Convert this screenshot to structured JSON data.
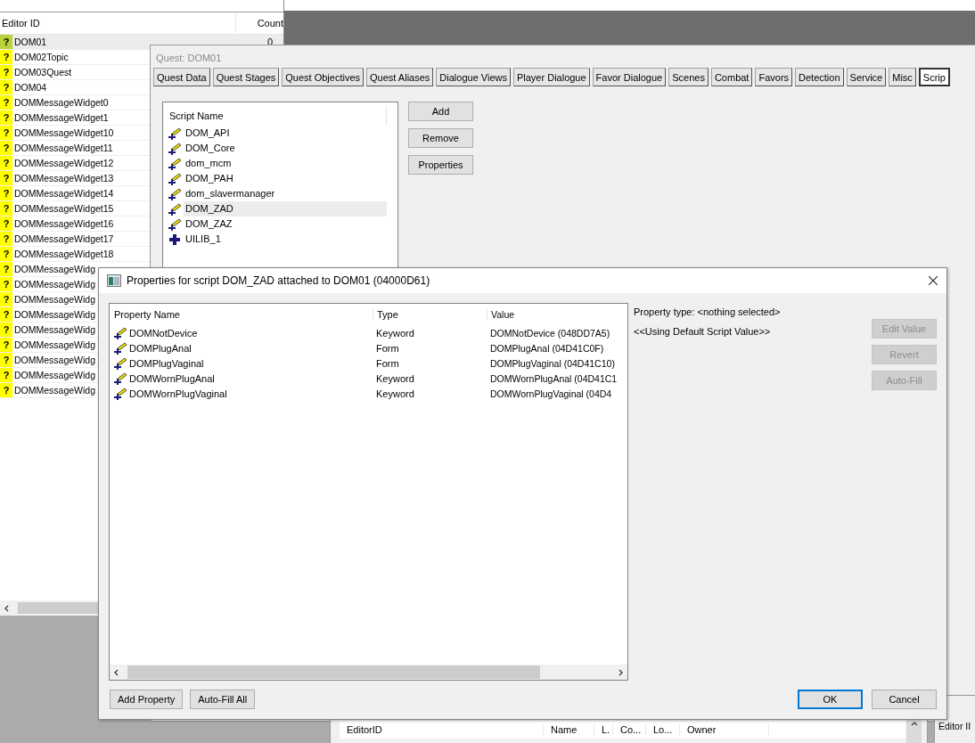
{
  "object_list": {
    "columns": [
      "Editor ID",
      "Count"
    ],
    "rows": [
      {
        "badge": "?",
        "editor_id": "DOM01",
        "count": "0",
        "selected": true
      },
      {
        "badge": "?",
        "editor_id": "DOM02Topic",
        "selected": false
      },
      {
        "badge": "?",
        "editor_id": "DOM03Quest",
        "selected": false
      },
      {
        "badge": "?",
        "editor_id": "DOM04",
        "selected": false
      },
      {
        "badge": "?",
        "editor_id": "DOMMessageWidget0",
        "selected": false
      },
      {
        "badge": "?",
        "editor_id": "DOMMessageWidget1",
        "selected": false
      },
      {
        "badge": "?",
        "editor_id": "DOMMessageWidget10",
        "selected": false
      },
      {
        "badge": "?",
        "editor_id": "DOMMessageWidget11",
        "selected": false
      },
      {
        "badge": "?",
        "editor_id": "DOMMessageWidget12",
        "selected": false
      },
      {
        "badge": "?",
        "editor_id": "DOMMessageWidget13",
        "selected": false
      },
      {
        "badge": "?",
        "editor_id": "DOMMessageWidget14",
        "selected": false
      },
      {
        "badge": "?",
        "editor_id": "DOMMessageWidget15",
        "selected": false
      },
      {
        "badge": "?",
        "editor_id": "DOMMessageWidget16",
        "selected": false
      },
      {
        "badge": "?",
        "editor_id": "DOMMessageWidget17",
        "selected": false
      },
      {
        "badge": "?",
        "editor_id": "DOMMessageWidget18",
        "selected": false
      },
      {
        "badge": "?",
        "editor_id": "DOMMessageWidg",
        "selected": false
      },
      {
        "badge": "?",
        "editor_id": "DOMMessageWidg",
        "selected": false
      },
      {
        "badge": "?",
        "editor_id": "DOMMessageWidg",
        "selected": false
      },
      {
        "badge": "?",
        "editor_id": "DOMMessageWidg",
        "selected": false
      },
      {
        "badge": "?",
        "editor_id": "DOMMessageWidg",
        "selected": false
      },
      {
        "badge": "?",
        "editor_id": "DOMMessageWidg",
        "selected": false
      },
      {
        "badge": "?",
        "editor_id": "DOMMessageWidg",
        "selected": false
      },
      {
        "badge": "?",
        "editor_id": "DOMMessageWidg",
        "selected": false
      },
      {
        "badge": "?",
        "editor_id": "DOMMessageWidg",
        "selected": false
      }
    ]
  },
  "quest_window": {
    "title": "Quest: DOM01",
    "tabs": [
      {
        "label": "Quest Data",
        "selected": false
      },
      {
        "label": "Quest Stages",
        "selected": false
      },
      {
        "label": "Quest Objectives",
        "selected": false
      },
      {
        "label": "Quest Aliases",
        "selected": false
      },
      {
        "label": "Dialogue Views",
        "selected": false
      },
      {
        "label": "Player Dialogue",
        "selected": false
      },
      {
        "label": "Favor Dialogue",
        "selected": false
      },
      {
        "label": "Scenes",
        "selected": false
      },
      {
        "label": "Combat",
        "selected": false
      },
      {
        "label": "Favors",
        "selected": false
      },
      {
        "label": "Detection",
        "selected": false
      },
      {
        "label": "Service",
        "selected": false
      },
      {
        "label": "Misc",
        "selected": false
      },
      {
        "label": "Scrip",
        "selected": true
      }
    ],
    "script_column": "Script Name",
    "scripts": [
      {
        "name": "DOM_API",
        "kind": "script",
        "selected": false
      },
      {
        "name": "DOM_Core",
        "kind": "script",
        "selected": false
      },
      {
        "name": "dom_mcm",
        "kind": "script",
        "selected": false
      },
      {
        "name": "DOM_PAH",
        "kind": "script",
        "selected": false
      },
      {
        "name": "dom_slavermanager",
        "kind": "script",
        "selected": false
      },
      {
        "name": "DOM_ZAD",
        "kind": "script",
        "selected": true
      },
      {
        "name": "DOM_ZAZ",
        "kind": "script",
        "selected": false
      },
      {
        "name": "UILIB_1",
        "kind": "plus",
        "selected": false
      }
    ],
    "buttons": [
      "Add",
      "Remove",
      "Properties"
    ]
  },
  "dialog": {
    "title": "Properties for script DOM_ZAD attached to DOM01 (04000D61)",
    "columns": [
      "Property Name",
      "Type",
      "Value"
    ],
    "properties": [
      {
        "name": "DOMNotDevice",
        "type": "Keyword",
        "value": "DOMNotDevice (048DD7A5)"
      },
      {
        "name": "DOMPlugAnal",
        "type": "Form",
        "value": "DOMPlugAnal (04D41C0F)"
      },
      {
        "name": "DOMPlugVaginal",
        "type": "Form",
        "value": "DOMPlugVaginal (04D41C10)"
      },
      {
        "name": "DOMWornPlugAnal",
        "type": "Keyword",
        "value": "DOMWornPlugAnal (04D41C1"
      },
      {
        "name": "DOMWornPlugVaginal",
        "type": "Keyword",
        "value": "DOMWornPlugVaginal (04D4"
      }
    ],
    "property_type": "Property type: <nothing selected>",
    "default_note": "<<Using Default Script Value>>",
    "side_buttons": [
      {
        "label": "Edit Value",
        "disabled": true
      },
      {
        "label": "Revert",
        "disabled": true
      },
      {
        "label": "Auto-Fill",
        "disabled": true
      }
    ],
    "bottom_buttons": [
      "Add Property",
      "Auto-Fill All"
    ],
    "ok": "OK",
    "cancel": "Cancel"
  },
  "bottom_list": {
    "columns": [
      "EditorID",
      "Name",
      "L.",
      "Co...",
      "Lo...",
      "Owner"
    ]
  },
  "right_list": {
    "columns": [
      "Editor II"
    ]
  }
}
